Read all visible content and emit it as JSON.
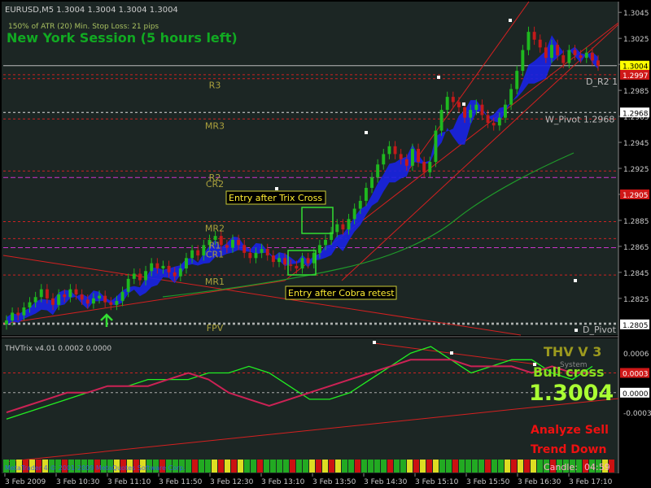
{
  "chart_data": [
    {
      "type": "candlestick",
      "title": "EURUSD,M5  1.3004 1.3004 1.3004 1.3004",
      "info_line": "150% of ATR (20)     Min. Stop Loss:  21 pips",
      "session_label": "New York Session (5 hours left)",
      "ylim": [
        1.2798,
        1.3052
      ],
      "y_ticks": [
        "1.3045",
        "1.3025",
        "1.3005",
        "1.2985",
        "1.2965",
        "1.2945",
        "1.2925",
        "1.2905",
        "1.2885",
        "1.2865",
        "1.2845",
        "1.2825"
      ],
      "price_tags": [
        {
          "value": 1.3004,
          "label": "1.3004",
          "style": "current"
        },
        {
          "value": 1.2997,
          "label": "1.2997",
          "style": "red"
        },
        {
          "value": 1.2968,
          "label": "1.2968",
          "style": "white"
        },
        {
          "value": 1.2905,
          "label": "1.2905",
          "style": "red"
        },
        {
          "value": 1.2805,
          "label": "1.2805",
          "style": "white"
        }
      ],
      "levels": [
        {
          "label": "R3",
          "value": 1.2994,
          "color": "#cc2222"
        },
        {
          "label": "D_R2 1",
          "value": 1.2997,
          "color": "#cc2222"
        },
        {
          "label": "W_Pivot 1.2968",
          "value": 1.2968,
          "color": "#dddddd"
        },
        {
          "label": "MR3",
          "value": 1.2963,
          "color": "#cc2222"
        },
        {
          "label": "R2",
          "value": 1.2923,
          "color": "#cc2222"
        },
        {
          "label": "CR2",
          "value": 1.2918,
          "color": "#cc33cc"
        },
        {
          "label": "MR2",
          "value": 1.2884,
          "color": "#cc2222"
        },
        {
          "label": "R1",
          "value": 1.2871,
          "color": "#cc2222"
        },
        {
          "label": "CR1",
          "value": 1.2864,
          "color": "#cc33cc"
        },
        {
          "label": "MR1",
          "value": 1.2843,
          "color": "#cc2222"
        },
        {
          "label": "FPV",
          "value": 1.2806,
          "color": "#dddddd"
        },
        {
          "label": "D_Pivot",
          "value": 1.2805,
          "color": "#dddddd"
        }
      ],
      "annotations": [
        "Entry after Trix Cross",
        "Entry after Cobra retest"
      ],
      "x_ticks": [
        "3 Feb 2009",
        "3 Feb 10:30",
        "3 Feb 11:10",
        "3 Feb 11:50",
        "3 Feb 12:30",
        "3 Feb 13:10",
        "3 Feb 13:50",
        "3 Feb 14:30",
        "3 Feb 15:10",
        "3 Feb 15:50",
        "3 Feb 16:30",
        "3 Feb 17:10"
      ],
      "closes": [
        1.2808,
        1.2814,
        1.2812,
        1.2818,
        1.2822,
        1.2826,
        1.2832,
        1.2825,
        1.282,
        1.2828,
        1.2826,
        1.2832,
        1.2828,
        1.2824,
        1.2821,
        1.2825,
        1.2827,
        1.2822,
        1.282,
        1.2823,
        1.283,
        1.284,
        1.2844,
        1.2839,
        1.2846,
        1.2852,
        1.2848,
        1.285,
        1.2845,
        1.2842,
        1.2848,
        1.2856,
        1.2862,
        1.2858,
        1.2866,
        1.287,
        1.2873,
        1.2866,
        1.2864,
        1.287,
        1.2866,
        1.286,
        1.2856,
        1.286,
        1.2863,
        1.2858,
        1.2853,
        1.2856,
        1.2851,
        1.285,
        1.2848,
        1.2856,
        1.2852,
        1.286,
        1.2866,
        1.287,
        1.2876,
        1.2882,
        1.2878,
        1.2886,
        1.2894,
        1.29,
        1.291,
        1.2918,
        1.2928,
        1.2936,
        1.2942,
        1.2936,
        1.2932,
        1.2927,
        1.294,
        1.293,
        1.2922,
        1.293,
        1.2954,
        1.297,
        1.298,
        1.2976,
        1.2972,
        1.2964,
        1.297,
        1.2974,
        1.2966,
        1.296,
        1.2958,
        1.2964,
        1.2974,
        1.2986,
        1.3,
        1.3016,
        1.303,
        1.3024,
        1.3018,
        1.301,
        1.302,
        1.3012,
        1.3006,
        1.3016,
        1.3012,
        1.301,
        1.3014,
        1.3008,
        1.3004
      ]
    },
    {
      "type": "line",
      "title": "THVTrix v4.01 0.0002 0.0000",
      "ylim": [
        -0.0012,
        0.0008
      ],
      "y_ticks": [
        "0.0006",
        "0.0003",
        "0.0000",
        "-0.0003"
      ],
      "value_tags": [
        {
          "value": 0.0003,
          "label": "0.0003",
          "style": "red"
        },
        {
          "value": 0.0,
          "label": "0.0000",
          "style": "white"
        }
      ],
      "series": [
        {
          "color": "#22ee22",
          "values": [
            -0.0004,
            -0.0003,
            -0.0002,
            -0.0001,
            0.0,
            0.0001,
            0.0001,
            0.0002,
            0.0002,
            0.0002,
            0.0003,
            0.0003,
            0.0004,
            0.0003,
            0.0001,
            -0.0001,
            -0.0001,
            0.0,
            0.0002,
            0.0004,
            0.0006,
            0.0007,
            0.0005,
            0.0003,
            0.0004,
            0.0005,
            0.0005,
            0.0003,
            0.0002,
            0.0004
          ]
        },
        {
          "color": "#cc2255",
          "values": [
            -0.0003,
            -0.0002,
            -0.0001,
            0.0,
            0.0,
            0.0001,
            0.0001,
            0.0001,
            0.0002,
            0.0003,
            0.0002,
            0.0,
            -0.0001,
            -0.0002,
            -0.0001,
            0.0,
            0.0001,
            0.0002,
            0.0003,
            0.0004,
            0.0005,
            0.0005,
            0.0005,
            0.0004,
            0.0004,
            0.0004,
            0.0003,
            0.0004,
            0.0003,
            0.0003
          ]
        }
      ],
      "signals": {
        "brand": "THV V 3",
        "system": "System",
        "cross_label": "Bull cross",
        "price": "1.3004",
        "analyze": "Analyze Sell",
        "trend": "Trend Down"
      },
      "footer": {
        "copyright": "MetaTrader 4 © 2001-2009 MetaQuotes Software Corp.",
        "candle_label": "Candle:",
        "candle_time": "04:59"
      }
    }
  ]
}
